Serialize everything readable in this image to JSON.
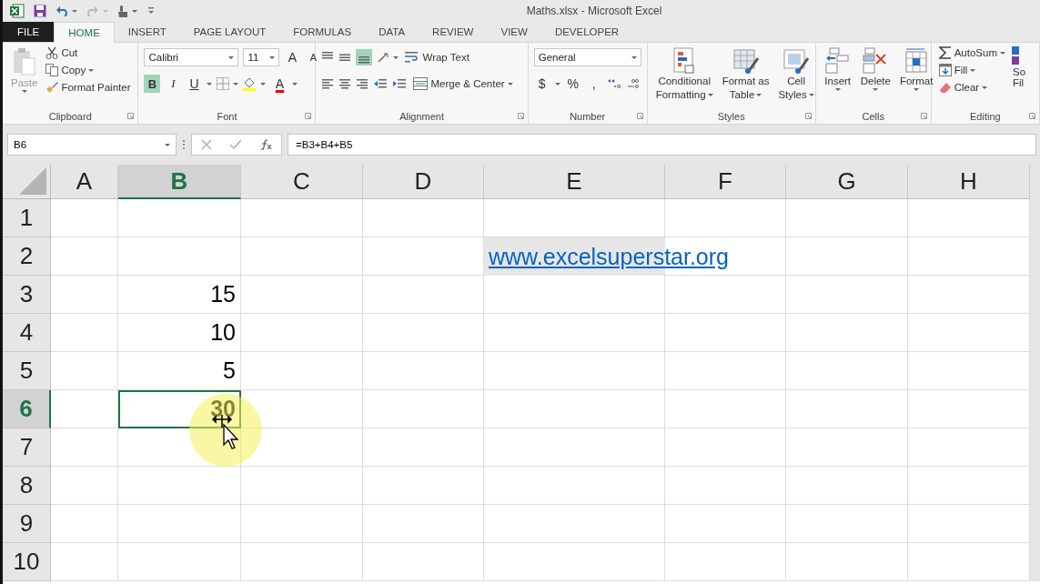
{
  "window": {
    "title": "Maths.xlsx - Microsoft Excel"
  },
  "tabs": [
    {
      "label": "FILE",
      "kind": "file",
      "selected": false
    },
    {
      "label": "HOME",
      "kind": "tab",
      "selected": true
    },
    {
      "label": "INSERT",
      "kind": "tab",
      "selected": false
    },
    {
      "label": "PAGE LAYOUT",
      "kind": "tab",
      "selected": false
    },
    {
      "label": "FORMULAS",
      "kind": "tab",
      "selected": false
    },
    {
      "label": "DATA",
      "kind": "tab",
      "selected": false
    },
    {
      "label": "REVIEW",
      "kind": "tab",
      "selected": false
    },
    {
      "label": "VIEW",
      "kind": "tab",
      "selected": false
    },
    {
      "label": "DEVELOPER",
      "kind": "tab",
      "selected": false
    }
  ],
  "ribbon": {
    "clipboard": {
      "label": "Clipboard",
      "paste": "Paste",
      "cut": "Cut",
      "copy": "Copy",
      "format_painter": "Format Painter"
    },
    "font": {
      "label": "Font",
      "font_name": "Calibri",
      "font_size": "11",
      "grow": "A",
      "shrink": "A",
      "bold": "B",
      "bold_on": true,
      "italic": "I",
      "underline": "U",
      "font_color": "A"
    },
    "alignment": {
      "label": "Alignment",
      "bottom_align_on": true,
      "wrap_text": "Wrap Text",
      "merge_center": "Merge & Center"
    },
    "number": {
      "label": "Number",
      "format": "General",
      "currency": "$",
      "percent": "%",
      "comma": ","
    },
    "styles": {
      "label": "Styles",
      "buttons": [
        {
          "kind": "conditional",
          "lines": [
            "Conditional",
            "Formatting"
          ]
        },
        {
          "kind": "table",
          "lines": [
            "Format as",
            "Table"
          ]
        },
        {
          "kind": "cellstyles",
          "lines": [
            "Cell",
            "Styles"
          ]
        }
      ]
    },
    "cells": {
      "label": "Cells",
      "buttons": [
        {
          "kind": "insert",
          "label": "Insert"
        },
        {
          "kind": "delete",
          "label": "Delete"
        },
        {
          "kind": "format",
          "label": "Format"
        }
      ]
    },
    "editing": {
      "label": "Editing",
      "autosum": "AutoSum",
      "fill": "Fill",
      "clear": "Clear",
      "sort_lines": [
        "So",
        "Fil"
      ]
    }
  },
  "formula_bar": {
    "name_box": "B6",
    "formula": "=B3+B4+B5"
  },
  "sheet": {
    "columns": [
      {
        "label": "A",
        "selected": false
      },
      {
        "label": "B",
        "selected": true
      },
      {
        "label": "C",
        "selected": false
      },
      {
        "label": "D",
        "selected": false
      },
      {
        "label": "E",
        "selected": false
      },
      {
        "label": "F",
        "selected": false
      },
      {
        "label": "G",
        "selected": false
      },
      {
        "label": "H",
        "selected": false
      }
    ],
    "rows": [
      {
        "label": "1",
        "selected": false,
        "cells": [
          null,
          null,
          null,
          null,
          null,
          null,
          null,
          null
        ]
      },
      {
        "label": "2",
        "selected": false,
        "cells": [
          null,
          null,
          null,
          null,
          {
            "kind": "link",
            "text": "www.excelsuperstar.org",
            "selected": false
          },
          null,
          null,
          null
        ]
      },
      {
        "label": "3",
        "selected": false,
        "cells": [
          null,
          {
            "kind": "number",
            "text": "15",
            "selected": false
          },
          null,
          null,
          null,
          null,
          null,
          null
        ]
      },
      {
        "label": "4",
        "selected": false,
        "cells": [
          null,
          {
            "kind": "number",
            "text": "10",
            "selected": false
          },
          null,
          null,
          null,
          null,
          null,
          null
        ]
      },
      {
        "label": "5",
        "selected": false,
        "cells": [
          null,
          {
            "kind": "number",
            "text": "5",
            "selected": false
          },
          null,
          null,
          null,
          null,
          null,
          null
        ]
      },
      {
        "label": "6",
        "selected": true,
        "cells": [
          null,
          {
            "kind": "number",
            "text": "30",
            "selected": true,
            "bold": true
          },
          null,
          null,
          null,
          null,
          null,
          null
        ]
      },
      {
        "label": "7",
        "selected": false,
        "cells": [
          null,
          null,
          null,
          null,
          null,
          null,
          null,
          null
        ]
      },
      {
        "label": "8",
        "selected": false,
        "cells": [
          null,
          null,
          null,
          null,
          null,
          null,
          null,
          null
        ]
      },
      {
        "label": "9",
        "selected": false,
        "cells": [
          null,
          null,
          null,
          null,
          null,
          null,
          null,
          null
        ]
      },
      {
        "label": "10",
        "selected": false,
        "cells": [
          null,
          null,
          null,
          null,
          null,
          null,
          null,
          null
        ]
      }
    ]
  }
}
